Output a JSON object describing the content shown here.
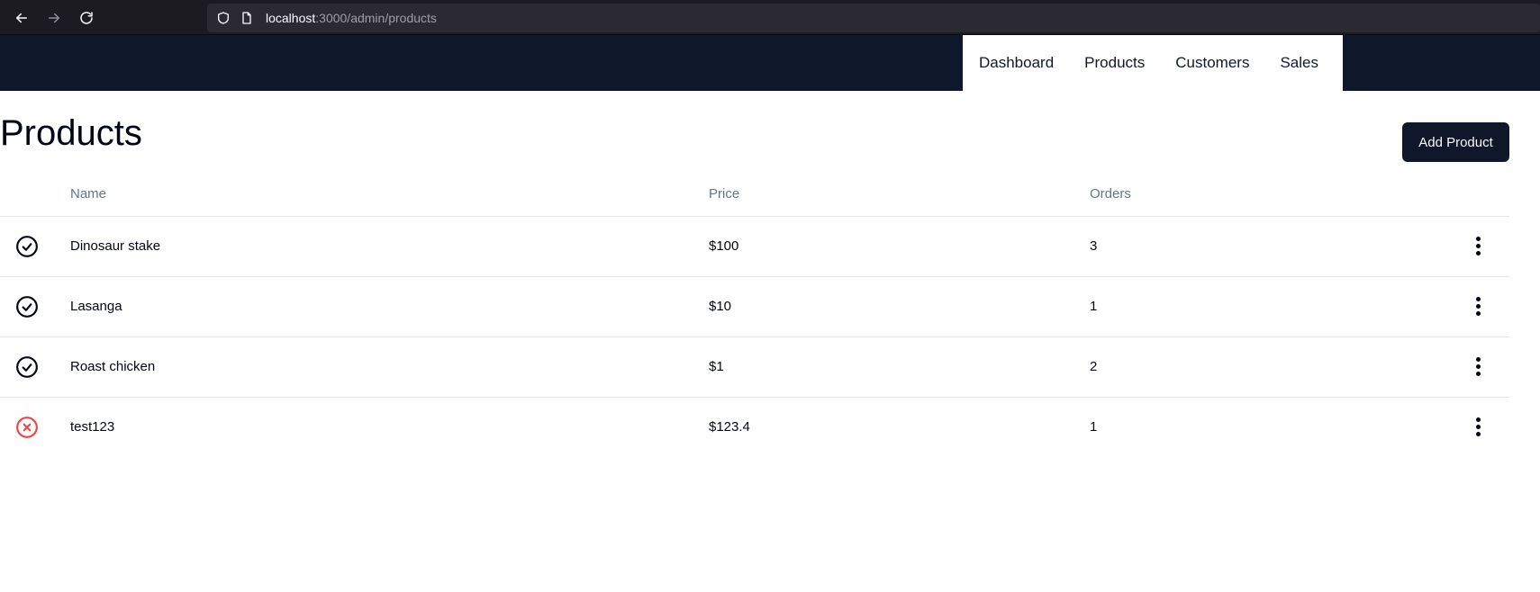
{
  "browser": {
    "url_host": "localhost",
    "url_rest": ":3000/admin/products"
  },
  "nav": {
    "items": [
      {
        "label": "Dashboard"
      },
      {
        "label": "Products"
      },
      {
        "label": "Customers"
      },
      {
        "label": "Sales"
      }
    ]
  },
  "page": {
    "title": "Products",
    "add_button": "Add Product"
  },
  "table": {
    "headers": {
      "name": "Name",
      "price": "Price",
      "orders": "Orders"
    },
    "rows": [
      {
        "status": "available",
        "status_icon": "check-circle-icon",
        "name": "Dinosaur stake",
        "price": "$100",
        "orders": "3"
      },
      {
        "status": "available",
        "status_icon": "check-circle-icon",
        "name": "Lasanga",
        "price": "$10",
        "orders": "1"
      },
      {
        "status": "available",
        "status_icon": "check-circle-icon",
        "name": "Roast chicken",
        "price": "$1",
        "orders": "2"
      },
      {
        "status": "unavailable",
        "status_icon": "x-circle-icon",
        "name": "test123",
        "price": "$123.4",
        "orders": "1"
      }
    ]
  },
  "colors": {
    "header_bg": "#0f172a",
    "available": "#020617",
    "unavailable": "#ef4444"
  }
}
